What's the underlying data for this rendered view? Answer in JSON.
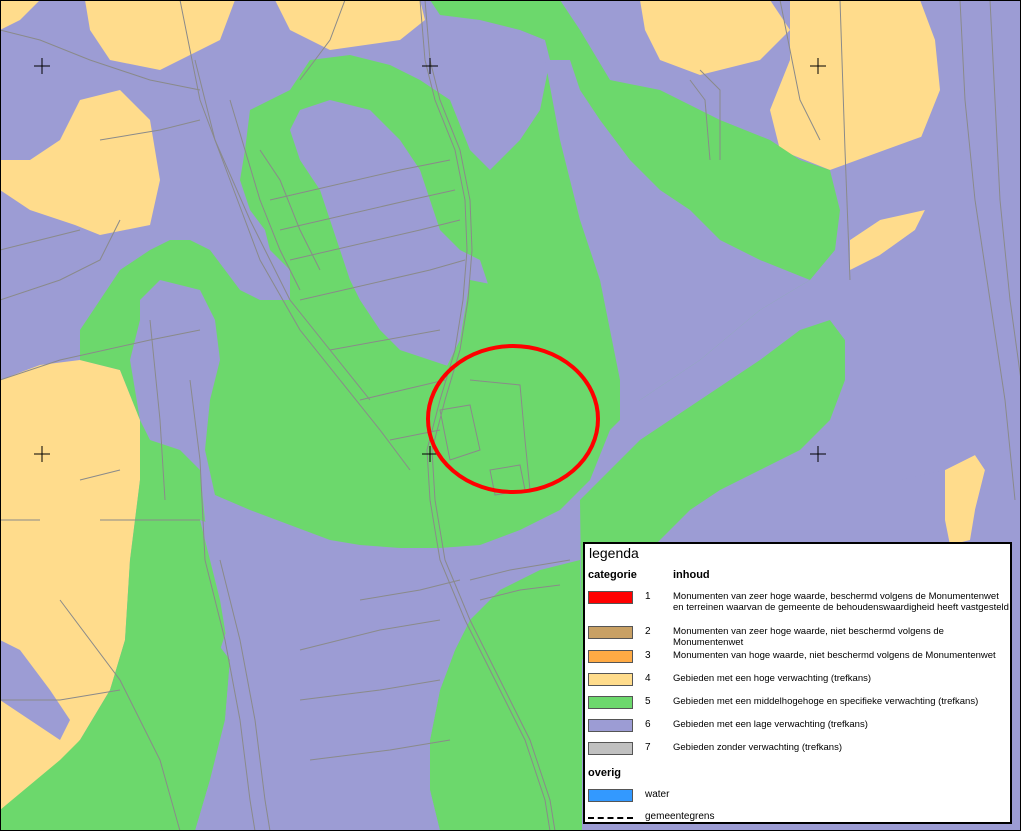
{
  "legend": {
    "title": "legenda",
    "col_category": "categorie",
    "col_content": "inhoud",
    "items": [
      {
        "num": "1",
        "color": "#ff0000",
        "text": "Monumenten van zeer hoge waarde, beschermd volgens de Monumentenwet en terreinen waarvan de gemeente de behoudenswaardigheid heeft vastgesteld"
      },
      {
        "num": "2",
        "color": "#c8a064",
        "text": "Monumenten van zeer hoge waarde, niet beschermd volgens de Monumentenwet"
      },
      {
        "num": "3",
        "color": "#ffaa44",
        "text": "Monumenten van hoge waarde, niet beschermd volgens de Monumentenwet"
      },
      {
        "num": "4",
        "color": "#ffdc8c",
        "text": "Gebieden met een hoge verwachting (trefkans)"
      },
      {
        "num": "5",
        "color": "#6cd86c",
        "text": "Gebieden met een middelhogehoge en specifieke verwachting (trefkans)"
      },
      {
        "num": "6",
        "color": "#9c9cd4",
        "text": "Gebieden met een lage verwachting (trefkans)"
      },
      {
        "num": "7",
        "color": "#c0c0c0",
        "text": "Gebieden zonder verwachting (trefkans)"
      }
    ],
    "other_title": "overig",
    "water_label": "water",
    "water_color": "#3399ff",
    "border_label": "gemeentegrens"
  },
  "map": {
    "colors": {
      "high": "#ffdc8c",
      "medium": "#6cd86c",
      "low": "#9c9cd4",
      "marker": "#ff0000",
      "lines": "#8a8a8a"
    }
  }
}
